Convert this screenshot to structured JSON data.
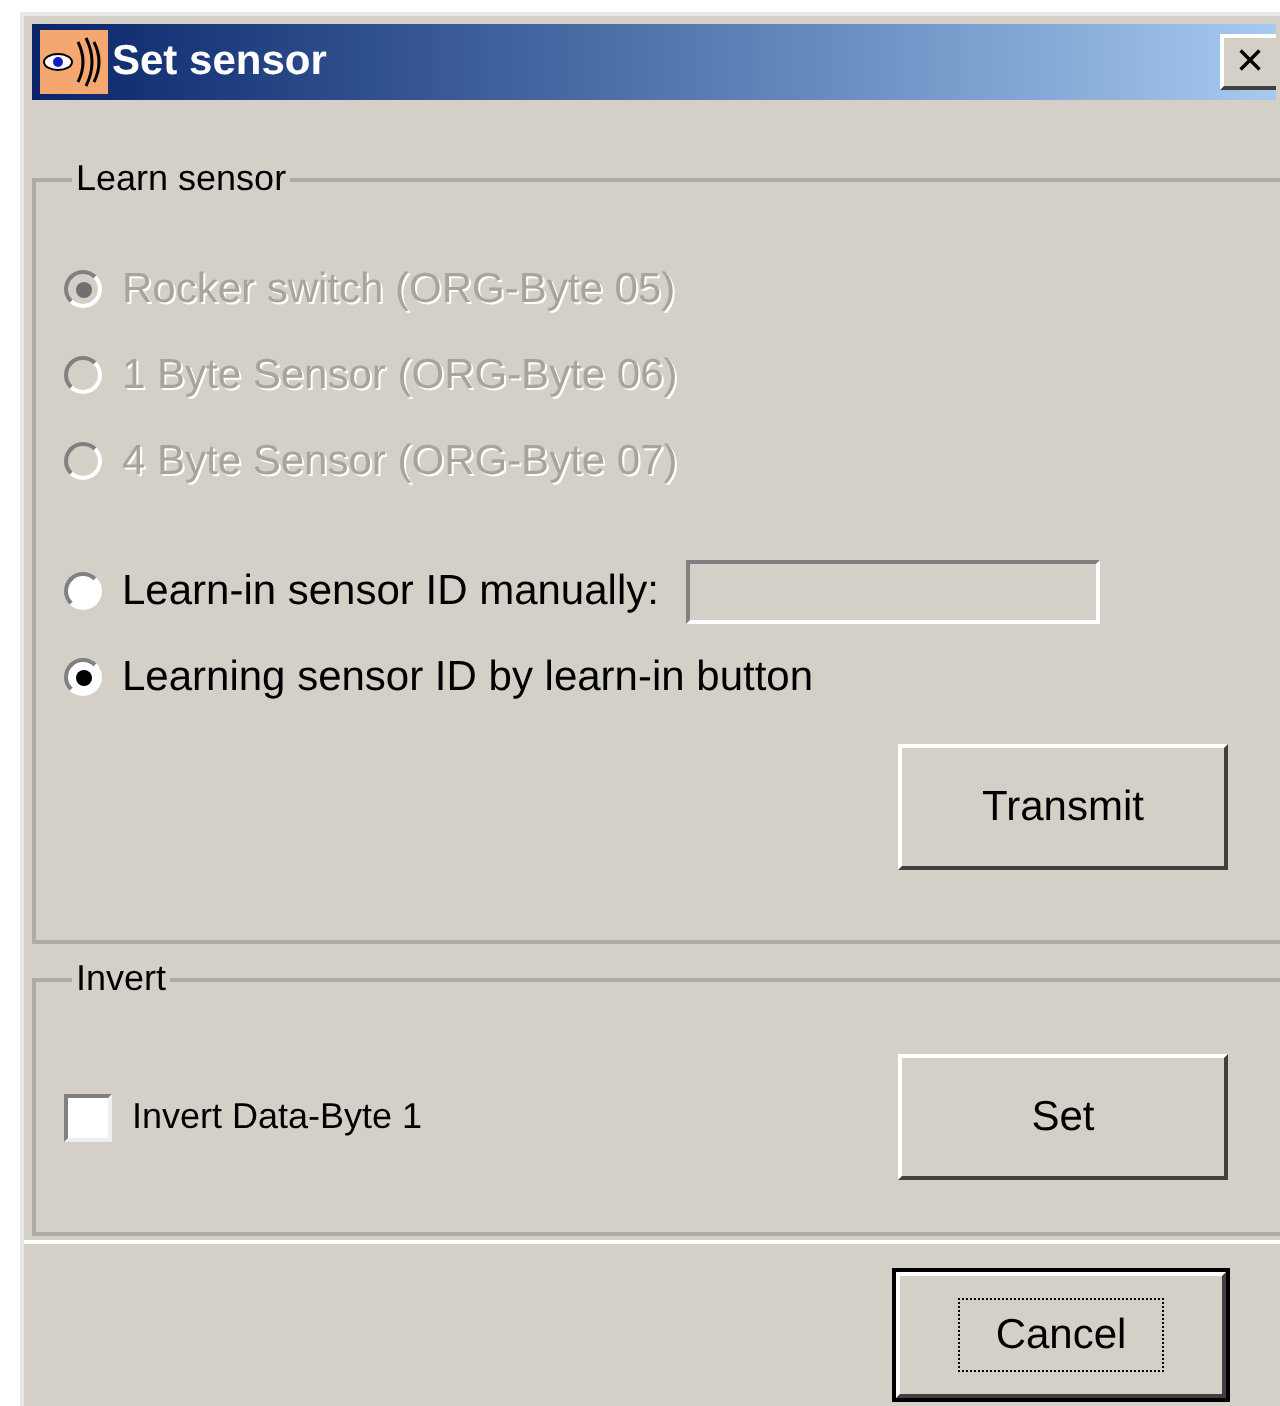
{
  "window": {
    "title": "Set sensor",
    "close": "×"
  },
  "learn_group": {
    "title": "Learn sensor",
    "options": [
      {
        "label": "Rocker switch (ORG-Byte 05)",
        "selected": true,
        "disabled": true
      },
      {
        "label": "1 Byte Sensor (ORG-Byte 06)",
        "selected": false,
        "disabled": true
      },
      {
        "label": "4 Byte Sensor (ORG-Byte 07)",
        "selected": false,
        "disabled": true
      },
      {
        "label": "Learn-in sensor ID manually:",
        "selected": false,
        "disabled": false,
        "kind": "field"
      },
      {
        "label": "Learning sensor ID by learn-in button",
        "selected": true,
        "disabled": false,
        "kind": "plain"
      }
    ],
    "button": "Transmit"
  },
  "invert_group": {
    "title": "Invert",
    "checkbox": {
      "label": "Invert Data-Byte 1",
      "checked": false
    },
    "button": "Set"
  },
  "footer_button": {
    "label": "Cancel",
    "focused": true
  }
}
